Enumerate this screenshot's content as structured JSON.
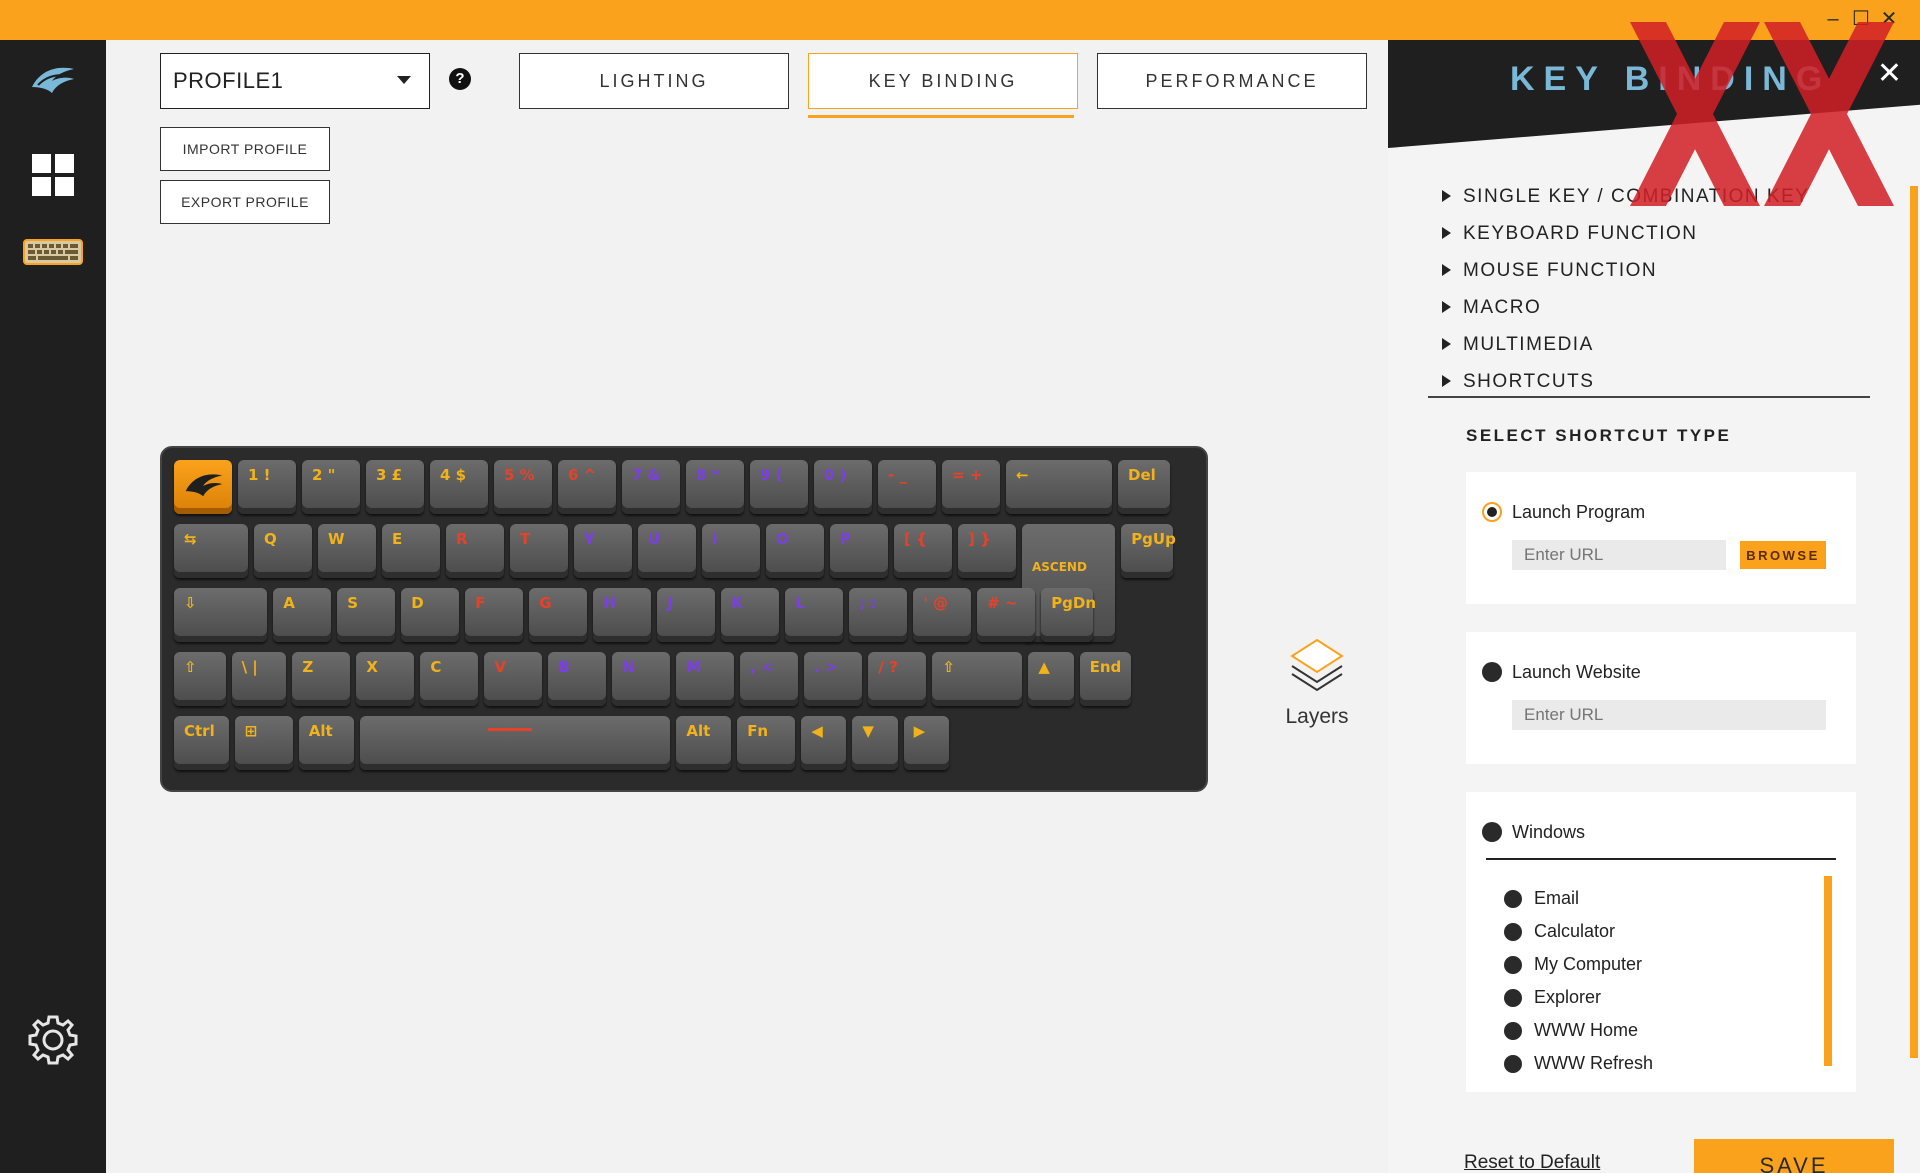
{
  "window": {
    "minimize_glyph": "–",
    "maximize_glyph": "☐",
    "close_glyph": "✕",
    "accent_color": "#fba21c"
  },
  "sidebar": {
    "items": [
      {
        "name": "logo",
        "icon": "wing-logo-icon"
      },
      {
        "name": "dashboard",
        "icon": "grid-icon"
      },
      {
        "name": "keyboard",
        "icon": "keyboard-icon",
        "active": true
      },
      {
        "name": "settings",
        "icon": "gear-icon"
      }
    ]
  },
  "header": {
    "profile_value": "PROFILE1",
    "help_glyph": "?",
    "import_label": "IMPORT PROFILE",
    "export_label": "EXPORT PROFILE",
    "tabs": [
      {
        "label": "LIGHTING",
        "active": false
      },
      {
        "label": "KEY BINDING",
        "active": true
      },
      {
        "label": "PERFORMANCE",
        "active": false
      }
    ]
  },
  "keyboard": {
    "rows": [
      [
        {
          "l": "",
          "logo": true
        },
        {
          "l": "1 !"
        },
        {
          "l": "2 \""
        },
        {
          "l": "3 £"
        },
        {
          "l": "4 $"
        },
        {
          "l": "5 %"
        },
        {
          "l": "6 ^"
        },
        {
          "l": "7 &"
        },
        {
          "l": "8 *"
        },
        {
          "l": "9 ("
        },
        {
          "l": "0 )"
        },
        {
          "l": "- _"
        },
        {
          "l": "= +"
        },
        {
          "l": "←"
        },
        {
          "l": "Del"
        }
      ],
      [
        {
          "l": "⇆"
        },
        {
          "l": "Q"
        },
        {
          "l": "W"
        },
        {
          "l": "E"
        },
        {
          "l": "R"
        },
        {
          "l": "T"
        },
        {
          "l": "Y"
        },
        {
          "l": "U"
        },
        {
          "l": "I"
        },
        {
          "l": "O"
        },
        {
          "l": "P"
        },
        {
          "l": "[ {"
        },
        {
          "l": "] }"
        },
        {
          "l": "ASCEND"
        },
        {
          "l": "PgUp"
        }
      ],
      [
        {
          "l": "⇩"
        },
        {
          "l": "A"
        },
        {
          "l": "S"
        },
        {
          "l": "D"
        },
        {
          "l": "F"
        },
        {
          "l": "G"
        },
        {
          "l": "H"
        },
        {
          "l": "J"
        },
        {
          "l": "K"
        },
        {
          "l": "L"
        },
        {
          "l": "; :"
        },
        {
          "l": "' @"
        },
        {
          "l": "# ~"
        },
        {
          "l": "PgDn"
        }
      ],
      [
        {
          "l": "⇧"
        },
        {
          "l": "\\ |"
        },
        {
          "l": "Z"
        },
        {
          "l": "X"
        },
        {
          "l": "C"
        },
        {
          "l": "V"
        },
        {
          "l": "B"
        },
        {
          "l": "N"
        },
        {
          "l": "M"
        },
        {
          "l": ", <"
        },
        {
          "l": ". >"
        },
        {
          "l": "/ ?"
        },
        {
          "l": "⇧"
        },
        {
          "l": "▲"
        },
        {
          "l": "End"
        }
      ],
      [
        {
          "l": "Ctrl"
        },
        {
          "l": "⊞"
        },
        {
          "l": "Alt"
        },
        {
          "l": ""
        },
        {
          "l": "Alt"
        },
        {
          "l": "Fn"
        },
        {
          "l": "◀"
        },
        {
          "l": "▼"
        },
        {
          "l": "▶"
        }
      ]
    ],
    "layers_label": "Layers"
  },
  "panel": {
    "title": "KEY BINDING",
    "close_glyph": "✕",
    "menu": [
      "SINGLE KEY / COMBINATION KEY",
      "KEYBOARD FUNCTION",
      "MOUSE FUNCTION",
      "MACRO",
      "MULTIMEDIA",
      "SHORTCUTS"
    ],
    "section_title": "SELECT SHORTCUT TYPE",
    "launch_program": {
      "label": "Launch Program",
      "selected": true,
      "url_placeholder": "Enter URL",
      "browse_label": "BROWSE"
    },
    "launch_website": {
      "label": "Launch Website",
      "selected": false,
      "url_placeholder": "Enter URL"
    },
    "windows": {
      "label": "Windows",
      "items": [
        "Email",
        "Calculator",
        "My Computer",
        "Explorer",
        "WWW Home",
        "WWW Refresh"
      ]
    },
    "reset_label": "Reset to Default",
    "save_label": "SAVE"
  }
}
